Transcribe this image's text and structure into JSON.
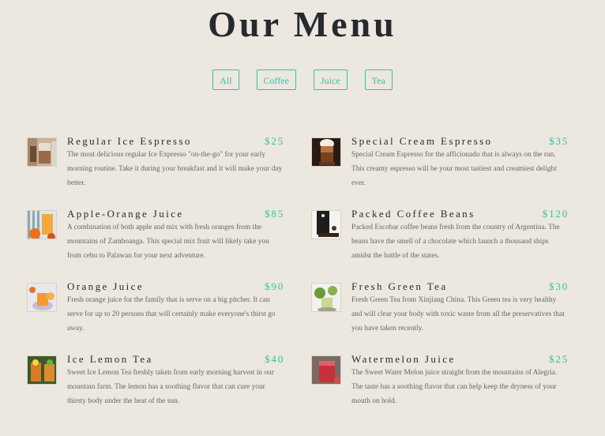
{
  "header": {
    "title": "Our Menu"
  },
  "filters": [
    {
      "label": "All"
    },
    {
      "label": "Coffee"
    },
    {
      "label": "Juice"
    },
    {
      "label": "Tea"
    }
  ],
  "items": [
    {
      "name": "Regular Ice Espresso",
      "price": "$25",
      "image": "iced-coffee-photo",
      "description": "The most delicious regular Ice Expresso \"on-the-go\" for your early morning routine. Take it during your breakfast and it will make your day better."
    },
    {
      "name": "Special Cream Espresso",
      "price": "$35",
      "image": "cream-espresso-photo",
      "description": "Special Cream Espresso for the afficionado that is always on the run. This creamy espresso will be your most tastiest and creamiest delight ever."
    },
    {
      "name": "Apple-Orange Juice",
      "price": "$85",
      "image": "apple-orange-juice-photo",
      "description": "A combination of both apple and mix with fresh oranges from the mountains of Zamboanga. This special mix fruit will likely take you from cebu to Palawan for your next adventure."
    },
    {
      "name": "Packed Coffee Beans",
      "price": "$120",
      "image": "coffee-beans-pack-photo",
      "description": "Packed Escobar coffee beans fresh from the country of Argentina. The beans have the smell of a chocolate which launch a thousand ships amidst the battle of the states."
    },
    {
      "name": "Orange Juice",
      "price": "$90",
      "image": "orange-juice-photo",
      "description": "Fresh orange juice for the family that is serve on a big pitcher. It can serve for up to 20 persons that will certainly make everyone's thirst go away."
    },
    {
      "name": "Fresh Green Tea",
      "price": "$30",
      "image": "green-tea-photo",
      "description": "Fresh Green Tea from Xinjiang China. This Green tea is very healthy and will clear your body with toxic waste from all the preservatives that you have taken recently."
    },
    {
      "name": "Ice Lemon Tea",
      "price": "$40",
      "image": "lemon-tea-photo",
      "description": "Sweet Ice Lemon Tea freshly taken from early morning harvest in our mountain farm. The lemon has a soothing flavor that can cure your thirsty body under the heat of the sun."
    },
    {
      "name": "Watermelon Juice",
      "price": "$25",
      "image": "watermelon-juice-photo",
      "description": "The Sweet Water Melon juice straight from the mountains of Alegria. The taste has a soothing flavor that can help keep the dryness of your mouth on hold."
    }
  ]
}
